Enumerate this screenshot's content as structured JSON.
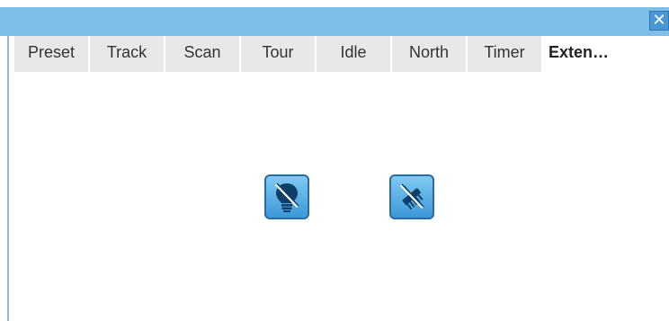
{
  "window": {
    "close_glyph": "✕",
    "close_icon": "close-icon"
  },
  "tabs": [
    {
      "label": "Preset"
    },
    {
      "label": "Track"
    },
    {
      "label": "Scan"
    },
    {
      "label": "Tour"
    },
    {
      "label": "Idle"
    },
    {
      "label": "North"
    },
    {
      "label": "Timer"
    },
    {
      "label": "Exten…",
      "active": true
    }
  ],
  "tools": [
    {
      "icon": "light-off-icon"
    },
    {
      "icon": "wiper-off-icon"
    }
  ],
  "colors": {
    "title_bar": "#7dbfe6",
    "tab_background": "#e8e8e8",
    "button_gradient_top": "#7fcaf2",
    "button_gradient_bottom": "#3c97d8"
  }
}
